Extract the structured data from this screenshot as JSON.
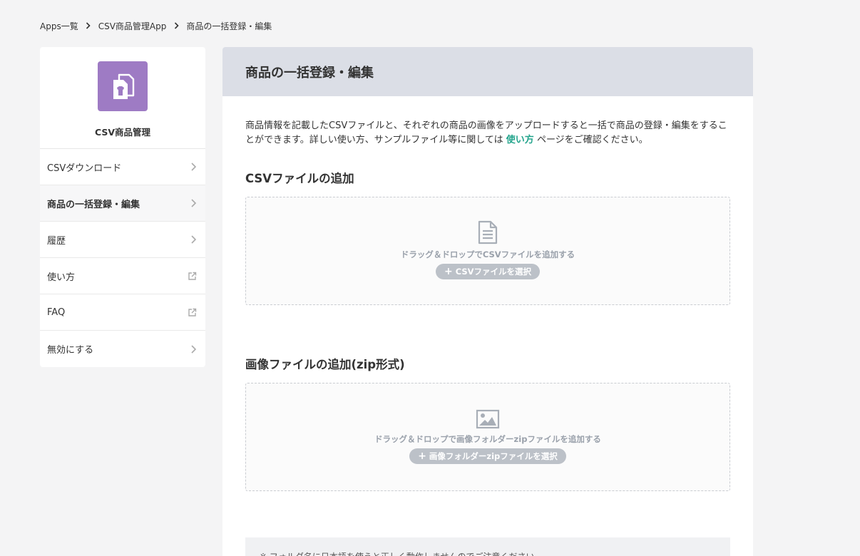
{
  "breadcrumb": [
    "Apps一覧",
    "CSV商品管理App",
    "商品の一括登録・編集"
  ],
  "sidebar": {
    "app_name": "CSV商品管理",
    "items": [
      {
        "label": "CSVダウンロード",
        "icon": "chevron-right-icon"
      },
      {
        "label": "商品の一括登録・編集",
        "icon": "chevron-right-icon",
        "active": true
      },
      {
        "label": "履歴",
        "icon": "chevron-right-icon"
      },
      {
        "label": "使い方",
        "icon": "external-link-icon"
      },
      {
        "label": "FAQ",
        "icon": "external-link-icon"
      },
      {
        "label": "無効にする",
        "icon": "chevron-right-icon"
      }
    ]
  },
  "main": {
    "title": "商品の一括登録・編集",
    "intro_before": "商品情報を記載したCSVファイルと、それぞれの商品の画像をアップロードすると一括で商品の登録・編集をすることができます。詳しい使い方、サンプルファイル等に関しては ",
    "intro_link": "使い方",
    "intro_after": " ページをご確認ください。",
    "csv_section": {
      "title": "CSVファイルの追加",
      "drop_text": "ドラッグ＆ドロップでCSVファイルを追加する",
      "button_label": "CSVファイルを選択"
    },
    "image_section": {
      "title": "画像ファイルの追加(zip形式)",
      "drop_text": "ドラッグ＆ドロップで画像フォルダーzipファイルを追加する",
      "button_label": "画像フォルダーzipファイルを選択"
    },
    "note": "※ フォルダ名に日本語を使うと正しく動作しませんのでご注意ください"
  },
  "colors": {
    "accent_link": "#23a48c",
    "app_icon_bg": "#9e7bc4",
    "header_bg": "#dbdee6",
    "page_bg": "#f4f4f5"
  }
}
